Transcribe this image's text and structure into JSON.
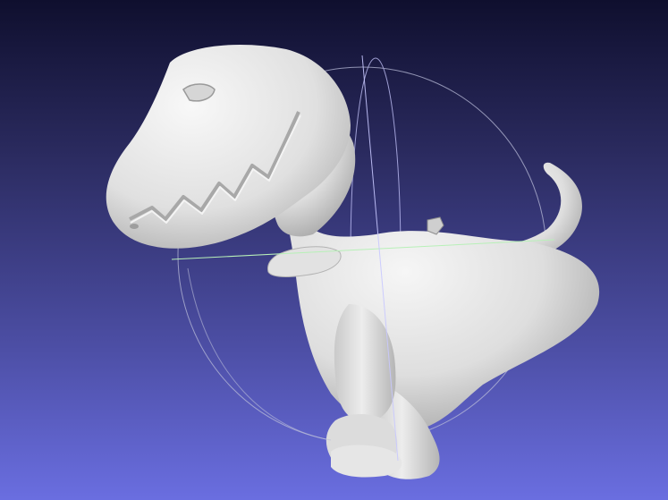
{
  "viewer": {
    "background_top": "#0f0f2e",
    "background_bottom": "#6a6ee0",
    "model_color": "#e4e4e4",
    "model_shadow_color": "#a9a9a9",
    "trackball_ring_color": "#b9bcd8",
    "trackball_axis_x_color": "#b8f0b8",
    "trackball_axis_y_color": "#c8c8ff",
    "model_icon": "dinosaur-mesh-icon"
  }
}
